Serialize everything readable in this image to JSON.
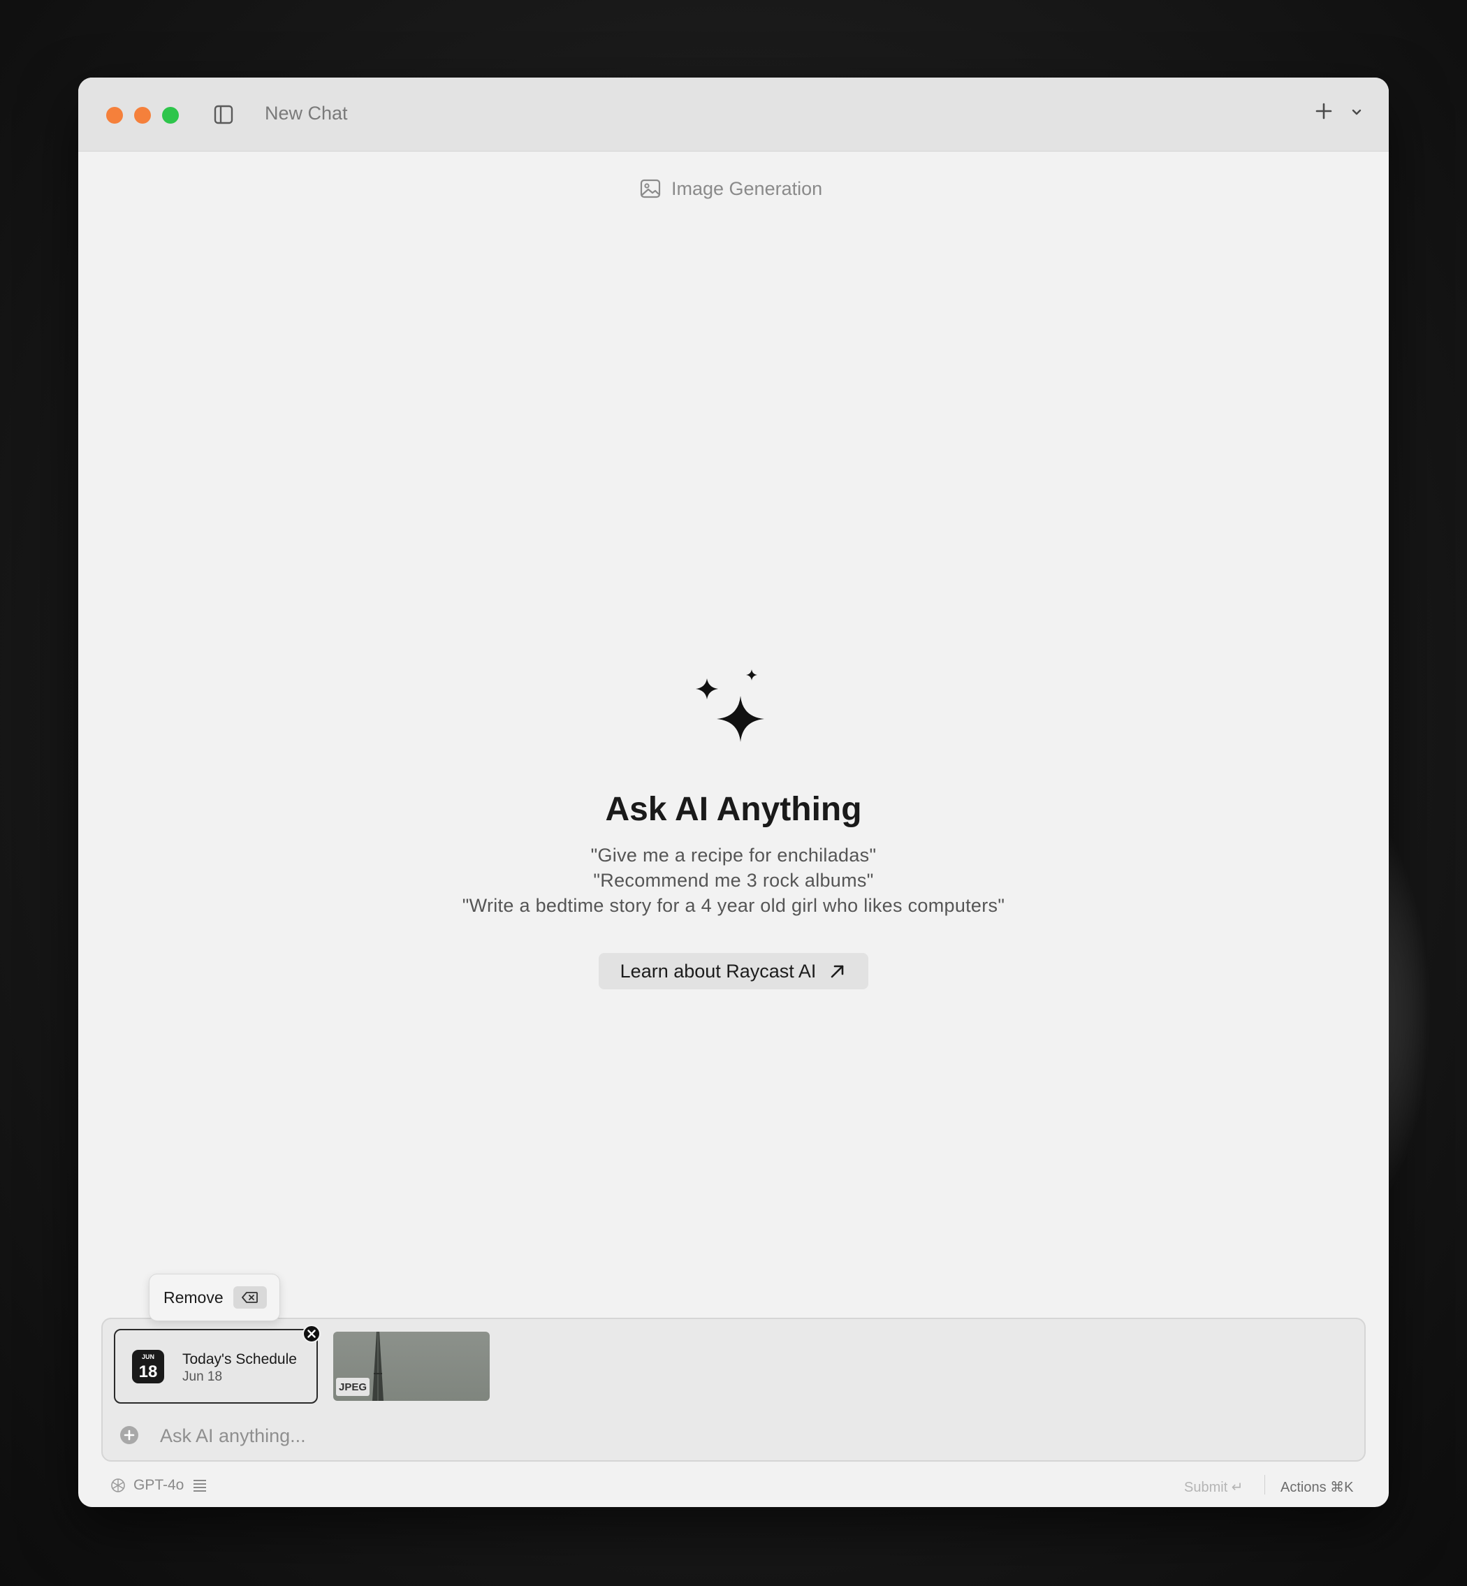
{
  "window": {
    "title": "New Chat"
  },
  "mode": {
    "label": "Image Generation",
    "icon": "image-icon"
  },
  "empty_state": {
    "headline": "Ask AI Anything",
    "suggestions": [
      "\"Give me a recipe for enchiladas\"",
      "\"Recommend me 3 rock albums\"",
      "\"Write a bedtime story for a 4 year old girl who likes computers\""
    ],
    "learn_button": "Learn about Raycast AI"
  },
  "tooltip": {
    "label": "Remove"
  },
  "attachments": [
    {
      "type": "calendar",
      "title": "Today's Schedule",
      "subtitle": "Jun 18",
      "icon_month": "JUN",
      "icon_day": "18"
    },
    {
      "type": "image",
      "badge": "JPEG"
    }
  ],
  "composer": {
    "placeholder": "Ask AI anything..."
  },
  "footer": {
    "model": "GPT-4o",
    "submit_label": "Submit ↵",
    "actions_label": "Actions ⌘K"
  },
  "colors": {
    "traffic_close": "#f5803b",
    "traffic_min": "#f5803b",
    "traffic_max": "#2ec54b",
    "background": "#f2f2f2"
  }
}
